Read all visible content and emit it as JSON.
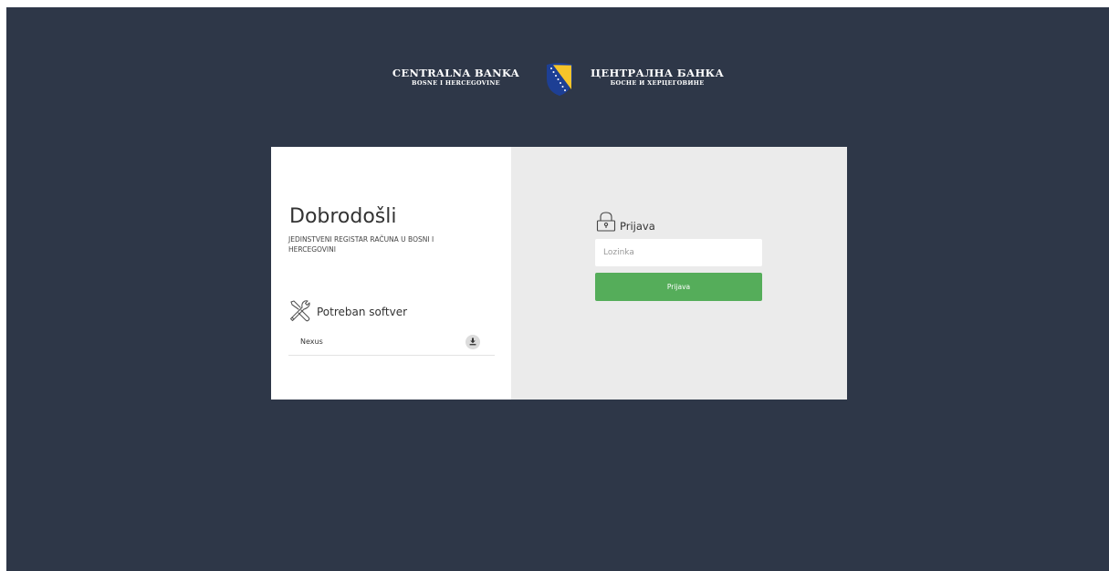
{
  "header": {
    "bank_name_latin": "CENTRALNA BANKA",
    "bank_sub_latin": "BOSNE I HERCEGOVINE",
    "bank_name_cyrillic": "ЦЕНТРАЛНА БАНКА",
    "bank_sub_cyrillic": "БОСНЕ И ХЕРЦЕГОВИНЕ",
    "emblem_icon": "bih-coat-of-arms-shield"
  },
  "welcome": {
    "title": "Dobrodošli",
    "subtitle": "JEDINSTVENI REGISTAR RAČUNA U BOSNI I HERCEGOVINI"
  },
  "software": {
    "icon": "tools-icon",
    "heading": "Potreban softver",
    "items": [
      {
        "name": "Nexus",
        "action_icon": "download-icon"
      }
    ]
  },
  "login": {
    "icon": "lock-icon",
    "heading": "Prijava",
    "password_placeholder": "Lozinka",
    "password_value": "",
    "submit_label": "Prijava"
  },
  "colors": {
    "background": "#2e3748",
    "card_left": "#ffffff",
    "card_right": "#ebebeb",
    "primary_button": "#55ad5a",
    "shield_blue": "#1d3f94",
    "shield_yellow": "#f6c42a"
  }
}
